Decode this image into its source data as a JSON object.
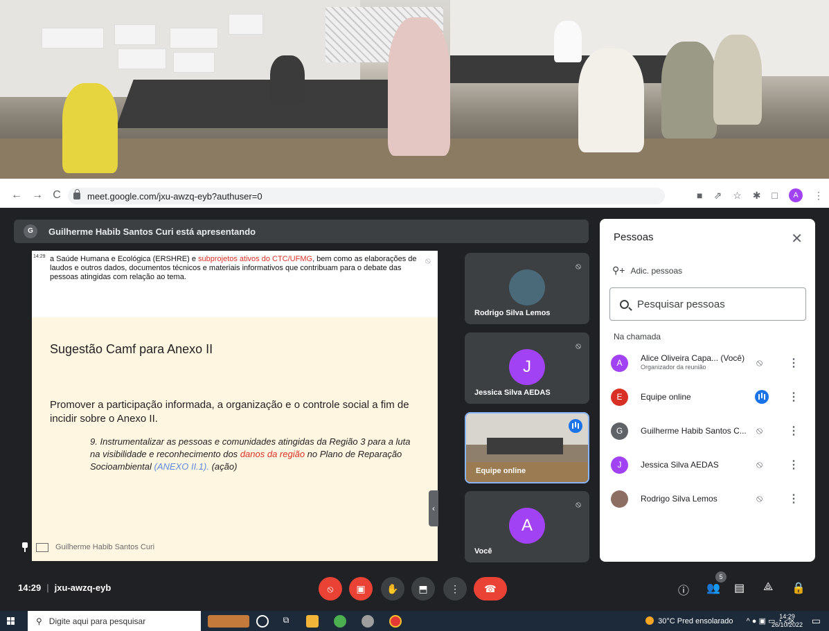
{
  "browser": {
    "url": "meet.google.com/jxu-awzq-eyb?authuser=0",
    "profile_initial": "A"
  },
  "meet": {
    "presenter_banner": "Guilherme Habib Santos Curi está apresentando",
    "presenter_initial": "G",
    "slide": {
      "tiny_header": "14:29",
      "top_text_1": "a Saúde Humana e Ecológica (ERSHRE) e ",
      "top_text_red": "subprojetos ativos do CTC/UFMG",
      "top_text_2": ", bem como as elaborações de laudos e outros dados, documentos técnicos e materiais informativos que contribuam para o debate das pessoas atingidas com relação ao tema.",
      "title": "Sugestão Camf para Anexo II",
      "main": "Promover a participação informada, a organização e o controle social a fim de incidir sobre o Anexo II.",
      "item_1": "9. Instrumentalizar as pessoas e comunidades atingidas da Região 3 para a luta na visibilidade e reconhecimento dos ",
      "item_red": "danos da região",
      "item_2": " no Plano de Reparação Socioambiental ",
      "item_blue": "(ANEXO II.1).",
      "item_3": " (ação)"
    },
    "self_label": "Guilherme Habib Santos Curi",
    "tiles": [
      {
        "name": "Rodrigo Silva Lemos",
        "initial": ""
      },
      {
        "name": "Jessica Silva AEDAS",
        "initial": "J"
      },
      {
        "name": "Equipe online",
        "initial": ""
      },
      {
        "name": "Você",
        "initial": "A"
      }
    ],
    "people_panel": {
      "title": "Pessoas",
      "add_label": "Adic. pessoas",
      "search_placeholder": "Pesquisar pessoas",
      "in_call_label": "Na chamada",
      "people": [
        {
          "name": "Alice Oliveira Capa...  (Você)",
          "sub": "Organizador da reunião",
          "initial": "A",
          "color": "#a142f4"
        },
        {
          "name": "Equipe online",
          "sub": "",
          "initial": "E",
          "color": "#d93025"
        },
        {
          "name": "Guilherme Habib Santos C...",
          "sub": "",
          "initial": "G",
          "color": "#5f6368"
        },
        {
          "name": "Jessica Silva AEDAS",
          "sub": "",
          "initial": "J",
          "color": "#a142f4"
        },
        {
          "name": "Rodrigo Silva Lemos",
          "sub": "",
          "initial": "",
          "color": "#8d6e63"
        }
      ]
    },
    "controls": {
      "time": "14:29",
      "meeting_code": "jxu-awzq-eyb",
      "participants_count": "5"
    }
  },
  "taskbar": {
    "search_placeholder": "Digite aqui para pesquisar",
    "weather": "30°C  Pred ensolarado",
    "time": "14:29",
    "date": "26/10/2022"
  },
  "colors": {
    "meet_bg": "#202124",
    "tile_bg": "#3c4043",
    "danger": "#ea4335",
    "accent": "#1a73e8"
  }
}
